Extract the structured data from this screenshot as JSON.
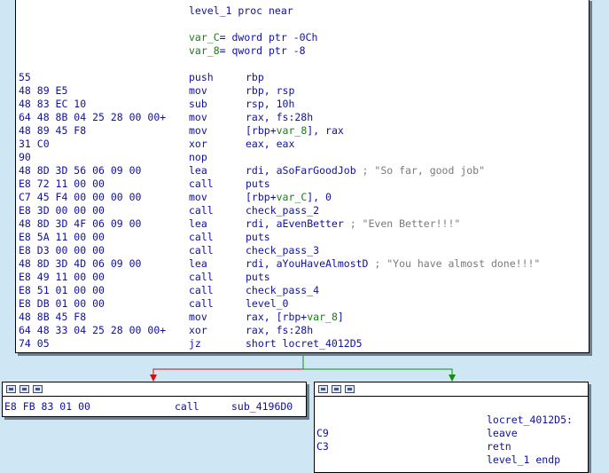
{
  "main_block": {
    "header": [
      {
        "t": "level_1 proc near",
        "cls": "c-label"
      },
      {
        "t": "",
        "cls": ""
      },
      {
        "parts": [
          [
            "var_C",
            "c-var"
          ],
          [
            "= dword ptr -0Ch",
            "c-ops"
          ]
        ]
      },
      {
        "parts": [
          [
            "var_8",
            "c-var"
          ],
          [
            "= qword ptr -8",
            "c-ops"
          ]
        ]
      },
      {
        "t": "",
        "cls": ""
      }
    ],
    "instructions": [
      {
        "bytes": "55",
        "mnem": "push",
        "ops": [
          [
            "rbp",
            "c-ops"
          ]
        ]
      },
      {
        "bytes": "48 89 E5",
        "mnem": "mov",
        "ops": [
          [
            "rbp, rsp",
            "c-ops"
          ]
        ]
      },
      {
        "bytes": "48 83 EC 10",
        "mnem": "sub",
        "ops": [
          [
            "rsp, 10h",
            "c-ops"
          ]
        ]
      },
      {
        "bytes": "64 48 8B 04 25 28 00 00+",
        "mnem": "mov",
        "ops": [
          [
            "rax, fs:28h",
            "c-ops"
          ]
        ]
      },
      {
        "bytes": "48 89 45 F8",
        "mnem": "mov",
        "ops": [
          [
            "[rbp+",
            "c-ops"
          ],
          [
            "var_8",
            "c-var"
          ],
          [
            "], rax",
            "c-ops"
          ]
        ]
      },
      {
        "bytes": "31 C0",
        "mnem": "xor",
        "ops": [
          [
            "eax, eax",
            "c-ops"
          ]
        ]
      },
      {
        "bytes": "90",
        "mnem": "nop",
        "ops": []
      },
      {
        "bytes": "48 8D 3D 56 06 09 00",
        "mnem": "lea",
        "ops": [
          [
            "rdi, aSoFarGoodJob",
            "c-ops"
          ],
          [
            " ; \"So far, good job\"",
            "c-cmt"
          ]
        ]
      },
      {
        "bytes": "E8 72 11 00 00",
        "mnem": "call",
        "ops": [
          [
            "puts",
            "c-ops"
          ]
        ]
      },
      {
        "bytes": "C7 45 F4 00 00 00 00",
        "mnem": "mov",
        "ops": [
          [
            "[rbp+",
            "c-ops"
          ],
          [
            "var_C",
            "c-var"
          ],
          [
            "], 0",
            "c-ops"
          ]
        ]
      },
      {
        "bytes": "E8 3D 00 00 00",
        "mnem": "call",
        "ops": [
          [
            "check_pass_2",
            "c-ops"
          ]
        ]
      },
      {
        "bytes": "48 8D 3D 4F 06 09 00",
        "mnem": "lea",
        "ops": [
          [
            "rdi, aEvenBetter",
            "c-ops"
          ],
          [
            " ; \"Even Better!!!\"",
            "c-cmt"
          ]
        ]
      },
      {
        "bytes": "E8 5A 11 00 00",
        "mnem": "call",
        "ops": [
          [
            "puts",
            "c-ops"
          ]
        ]
      },
      {
        "bytes": "E8 D3 00 00 00",
        "mnem": "call",
        "ops": [
          [
            "check_pass_3",
            "c-ops"
          ]
        ]
      },
      {
        "bytes": "48 8D 3D 4D 06 09 00",
        "mnem": "lea",
        "ops": [
          [
            "rdi, aYouHaveAlmostD",
            "c-ops"
          ],
          [
            " ; \"You have almost done!!!\"",
            "c-cmt"
          ]
        ]
      },
      {
        "bytes": "E8 49 11 00 00",
        "mnem": "call",
        "ops": [
          [
            "puts",
            "c-ops"
          ]
        ]
      },
      {
        "bytes": "E8 51 01 00 00",
        "mnem": "call",
        "ops": [
          [
            "check_pass_4",
            "c-ops"
          ]
        ]
      },
      {
        "bytes": "E8 DB 01 00 00",
        "mnem": "call",
        "ops": [
          [
            "level_0",
            "c-ops"
          ]
        ]
      },
      {
        "bytes": "48 8B 45 F8",
        "mnem": "mov",
        "ops": [
          [
            "rax, [rbp+",
            "c-ops"
          ],
          [
            "var_8",
            "c-var"
          ],
          [
            "]",
            "c-ops"
          ]
        ]
      },
      {
        "bytes": "64 48 33 04 25 28 00 00+",
        "mnem": "xor",
        "ops": [
          [
            "rax, fs:28h",
            "c-ops"
          ]
        ]
      },
      {
        "bytes": "74 05",
        "mnem": "jz",
        "ops": [
          [
            "short locret_4012D5",
            "c-ops"
          ]
        ]
      }
    ]
  },
  "left_block": {
    "instructions": [
      {
        "bytes": "E8 FB 83 01 00",
        "mnem": "call",
        "ops": [
          [
            "sub_4196D0",
            "c-ops"
          ]
        ]
      }
    ]
  },
  "right_block": {
    "label": "locret_4012D5:",
    "instructions": [
      {
        "bytes": "C9",
        "mnem": "leave",
        "ops": []
      },
      {
        "bytes": "C3",
        "mnem": "retn",
        "ops": []
      },
      {
        "bytes": "",
        "mnem": "level_1 endp",
        "ops": []
      }
    ]
  },
  "colors": {
    "background": "#cfe6f5",
    "false_edge": "#d01010",
    "true_edge": "#109010",
    "variable": "#1a7d1a",
    "comment": "#7a7a7a",
    "code": "#1010a0"
  },
  "icons": [
    "graph-icon",
    "flow-icon",
    "overview-icon"
  ]
}
